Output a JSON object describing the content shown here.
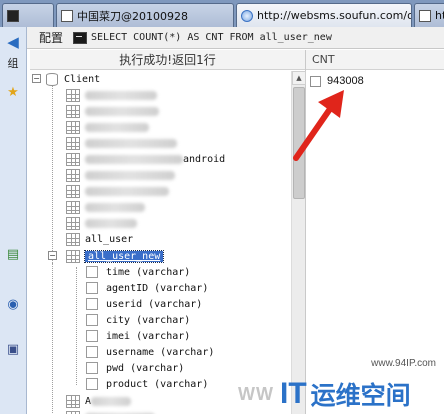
{
  "tabs": [
    {
      "label": "",
      "active": false
    },
    {
      "label": "中国菜刀@20100928",
      "active": false
    },
    {
      "label": "http://websms.soufun.com/o...",
      "active": true
    },
    {
      "label": "http",
      "active": false
    }
  ],
  "left_strip": {
    "labels": [
      "组"
    ]
  },
  "toolbar": {
    "config_label": "配置",
    "sql_query": "SELECT COUNT(*) AS CNT FROM all_user_new"
  },
  "left_panel": {
    "status": "执行成功!返回1行"
  },
  "right_panel": {
    "column_header": "CNT",
    "result_value": "943008"
  },
  "tree": {
    "root_label": "Client",
    "blurred_tables_suffix": "android",
    "all_user": "all_user",
    "all_user_new": "all_user_new",
    "columns": [
      "time (varchar)",
      "agentID (varchar)",
      "userid (varchar)",
      "city (varchar)",
      "imei (varchar)",
      "username (varchar)",
      "pwd (varchar)",
      "product (varchar)"
    ],
    "bottom_partial": "A"
  },
  "watermark": {
    "url": "www.94IP.com",
    "www": "WW",
    "it": "IT",
    "cn": "运维空间"
  },
  "colors": {
    "selection": "#3a6ec9",
    "arrow": "#e0251b",
    "brand": "#2b72c8"
  }
}
